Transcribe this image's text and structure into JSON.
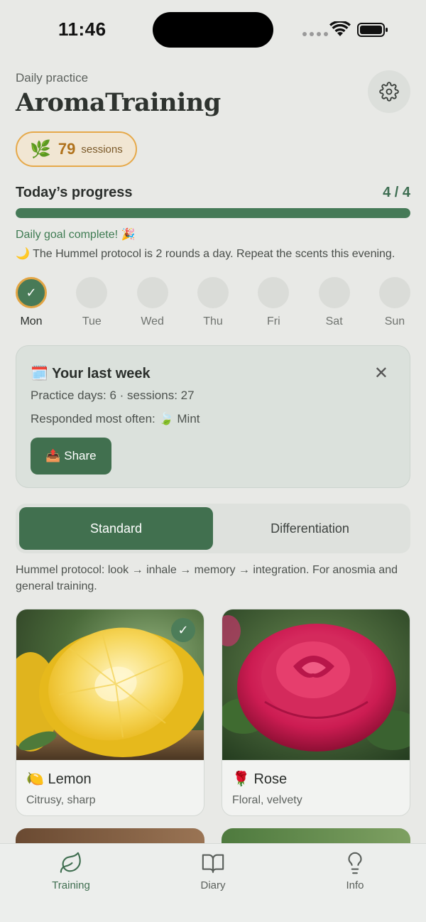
{
  "status_bar": {
    "time": "11:46"
  },
  "header": {
    "subtitle": "Daily practice",
    "title": "AromaTraining",
    "settings_icon": "gear-icon"
  },
  "sessions": {
    "emoji": "🌿",
    "count": "79",
    "label": "sessions"
  },
  "progress": {
    "label": "Today’s progress",
    "count_text": "4 / 4",
    "fraction": 1.0,
    "goal_text": "Daily goal complete! 🎉",
    "note_text": "🌙 The Hummel protocol is 2 rounds a day. Repeat the scents this evening."
  },
  "week_days": [
    {
      "name": "Mon",
      "done": true
    },
    {
      "name": "Tue",
      "done": false
    },
    {
      "name": "Wed",
      "done": false
    },
    {
      "name": "Thu",
      "done": false
    },
    {
      "name": "Fri",
      "done": false
    },
    {
      "name": "Sat",
      "done": false
    },
    {
      "name": "Sun",
      "done": false
    }
  ],
  "week_card": {
    "title": "🗓️ Your last week",
    "practice_line": "Practice days: 6 · sessions: 27",
    "responded_line": "Responded most often: 🍃 Mint",
    "share_label": "📤 Share",
    "close_icon": "close-icon"
  },
  "mode_tabs": {
    "standard": "Standard",
    "differentiation": "Differentiation",
    "active": "standard"
  },
  "protocol_description": "Hummel protocol: look → inhale → memory → integration. For anosmia and general training.",
  "scents": [
    {
      "name": "🍋 Lemon",
      "description": "Citrusy, sharp",
      "checked": true
    },
    {
      "name": "🌹 Rose",
      "description": "Floral, velvety",
      "checked": false
    }
  ],
  "nav": {
    "training": "Training",
    "diary": "Diary",
    "info": "Info",
    "active": "training"
  },
  "colors": {
    "accent_green": "#41704f",
    "accent_orange": "#e3a544",
    "background": "#e8e9e6"
  }
}
